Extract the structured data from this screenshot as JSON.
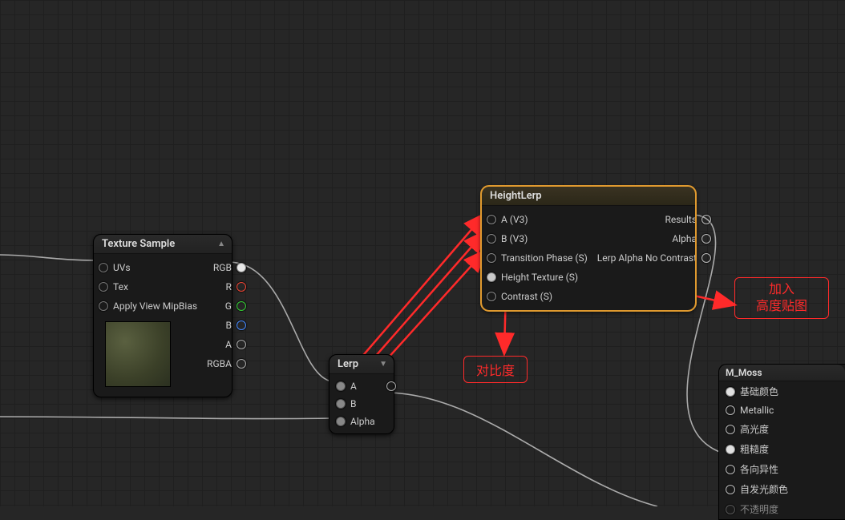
{
  "nodes": {
    "texture_sample": {
      "title": "Texture Sample",
      "inputs": {
        "uvs": "UVs",
        "tex": "Tex",
        "mip": "Apply View MipBias"
      },
      "outputs": {
        "rgb": "RGB",
        "r": "R",
        "g": "G",
        "b": "B",
        "a": "A",
        "rgba": "RGBA"
      }
    },
    "lerp": {
      "title": "Lerp",
      "inputs": {
        "a": "A",
        "b": "B",
        "alpha": "Alpha"
      }
    },
    "height_lerp": {
      "title": "HeightLerp",
      "inputs": {
        "a": "A (V3)",
        "b": "B (V3)",
        "phase": "Transition Phase (S)",
        "htex": "Height Texture (S)",
        "contrast": "Contrast (S)"
      },
      "outputs": {
        "results": "Results",
        "alpha": "Alpha",
        "nocontrast": "Lerp Alpha No Contrast"
      }
    },
    "moss": {
      "title": "M_Moss",
      "pins": {
        "base": "基础颜色",
        "metallic": "Metallic",
        "spec": "高光度",
        "rough": "粗糙度",
        "aniso": "各向异性",
        "emissive": "自发光颜色",
        "opacity": "不透明度"
      }
    }
  },
  "callouts": {
    "contrast": "对比度",
    "heightmap_line1": "加入",
    "heightmap_line2": "高度贴图"
  }
}
